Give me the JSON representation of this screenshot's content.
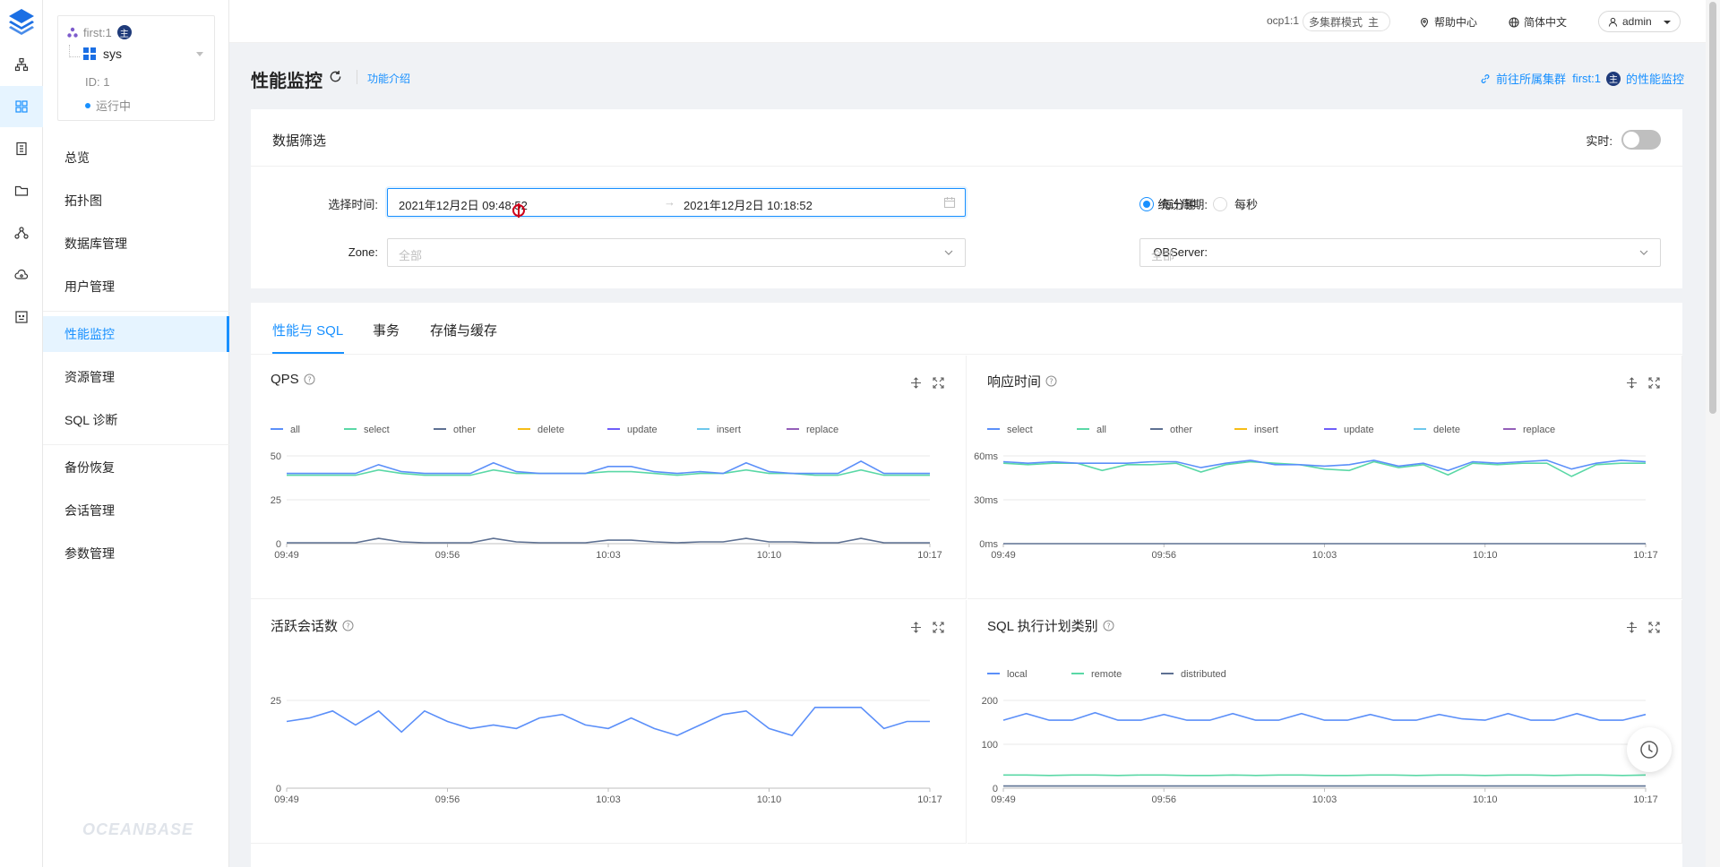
{
  "sidebar": {
    "cluster": "first:1",
    "main_badge": "主",
    "tenant": "sys",
    "tenant_id": "ID: 1",
    "status": "运行中",
    "menu": [
      "总览",
      "拓扑图",
      "数据库管理",
      "用户管理",
      "性能监控",
      "资源管理",
      "SQL 诊断",
      "备份恢复",
      "会话管理",
      "参数管理"
    ],
    "active": "性能监控",
    "brand": "OCEANBASE"
  },
  "topbar": {
    "ocp": "ocp1:1",
    "mode": "多集群模式",
    "mode_badge": "主",
    "help": "帮助中心",
    "lang": "简体中文",
    "user": "admin"
  },
  "page": {
    "title": "性能监控",
    "func_link": "功能介绍",
    "goto_prefix": "前往所属集群",
    "goto_cluster": "first:1",
    "goto_badge": "主",
    "goto_suffix": "的性能监控"
  },
  "filter": {
    "title": "数据筛选",
    "realtime_label": "实时:",
    "time_label": "选择时间:",
    "start": "2021年12月2日 09:48:52",
    "range_sep": "→",
    "end": "2021年12月2日 10:18:52",
    "period_label": "统计周期:",
    "period_options": [
      "每分钟",
      "每秒"
    ],
    "zone_label": "Zone:",
    "zone_placeholder": "全部",
    "observer_label": "OBServer:",
    "observer_placeholder": "全部"
  },
  "tabs": [
    "性能与 SQL",
    "事务",
    "存储与缓存"
  ],
  "colors": {
    "primary": "#1890ff",
    "series": [
      "#5b8ff9",
      "#5ad8a6",
      "#5d7092",
      "#f6bd16",
      "#6f5ef9",
      "#6dc8ec",
      "#945fb9"
    ]
  },
  "chart_data": [
    {
      "type": "line",
      "title": "QPS",
      "x_ticks": [
        "09:49",
        "09:56",
        "10:03",
        "10:10",
        "10:17"
      ],
      "y_ticks": [
        "0",
        "25",
        "50"
      ],
      "ylim": [
        0,
        50
      ],
      "legend": [
        "all",
        "select",
        "other",
        "delete",
        "update",
        "insert",
        "replace"
      ],
      "series": [
        {
          "name": "all",
          "values": [
            40,
            40,
            40,
            40,
            45,
            41,
            40,
            40,
            40,
            46,
            41,
            40,
            40,
            40,
            44,
            44,
            41,
            40,
            41,
            40,
            46,
            41,
            40,
            40,
            40,
            47,
            40,
            40,
            40
          ]
        },
        {
          "name": "select",
          "values": [
            39,
            39,
            39,
            39,
            42,
            40,
            39,
            39,
            39,
            42,
            40,
            40,
            40,
            40,
            41,
            41,
            40,
            39,
            40,
            40,
            42,
            40,
            40,
            39,
            39,
            42,
            39,
            39,
            39
          ]
        },
        {
          "name": "other",
          "values": [
            0.5,
            0.5,
            0.5,
            0.5,
            3,
            1,
            0.5,
            0.5,
            0.5,
            3,
            1,
            0.5,
            0.5,
            0.5,
            2,
            2,
            1,
            0.5,
            1,
            1,
            3,
            1,
            1,
            0.5,
            0.5,
            3,
            0.5,
            0.5,
            0.5
          ]
        }
      ]
    },
    {
      "type": "line",
      "title": "响应时间",
      "x_ticks": [
        "09:49",
        "09:56",
        "10:03",
        "10:10",
        "10:17"
      ],
      "y_ticks": [
        "0ms",
        "30ms",
        "60ms"
      ],
      "ylim": [
        0,
        60
      ],
      "legend": [
        "select",
        "all",
        "other",
        "insert",
        "update",
        "delete",
        "replace"
      ],
      "series": [
        {
          "name": "select",
          "values": [
            56,
            55,
            56,
            55,
            55,
            55,
            56,
            56,
            52,
            55,
            57,
            54,
            54,
            53,
            54,
            57,
            53,
            55,
            50,
            56,
            55,
            56,
            57,
            51,
            55,
            57,
            56
          ]
        },
        {
          "name": "all",
          "values": [
            55,
            54,
            55,
            55,
            50,
            54,
            54,
            55,
            49,
            54,
            56,
            55,
            54,
            51,
            50,
            56,
            52,
            54,
            47,
            55,
            54,
            55,
            55,
            46,
            54,
            55,
            55
          ]
        },
        {
          "name": "other",
          "values": [
            0,
            0,
            0,
            0,
            0,
            0,
            0,
            0,
            0,
            0,
            0,
            0,
            0,
            0,
            0,
            0,
            0,
            0,
            0,
            0,
            0,
            0,
            0,
            0,
            0,
            0,
            0
          ]
        }
      ]
    },
    {
      "type": "line",
      "title": "活跃会话数",
      "x_ticks": [
        "09:49",
        "09:56",
        "10:03",
        "10:10",
        "10:17"
      ],
      "y_ticks": [
        "0",
        "25"
      ],
      "ylim": [
        0,
        25
      ],
      "legend": [],
      "series": [
        {
          "name": "",
          "values": [
            19,
            20,
            22,
            18,
            22,
            16,
            22,
            19,
            17,
            18,
            17,
            20,
            21,
            18,
            17,
            20,
            17,
            15,
            18,
            21,
            22,
            17,
            15,
            23,
            23,
            23,
            17,
            19,
            19
          ]
        }
      ]
    },
    {
      "type": "line",
      "title": "SQL 执行计划类别",
      "x_ticks": [
        "09:49",
        "09:56",
        "10:03",
        "10:10",
        "10:17"
      ],
      "y_ticks": [
        "0",
        "100",
        "200"
      ],
      "ylim": [
        0,
        200
      ],
      "legend": [
        "local",
        "remote",
        "distributed"
      ],
      "series": [
        {
          "name": "local",
          "values": [
            155,
            170,
            155,
            155,
            172,
            155,
            155,
            168,
            155,
            155,
            170,
            155,
            155,
            170,
            155,
            155,
            168,
            155,
            155,
            168,
            158,
            155,
            170,
            155,
            155,
            170,
            155,
            155,
            168
          ]
        },
        {
          "name": "remote",
          "values": [
            30,
            30,
            29,
            30,
            30,
            29,
            30,
            30,
            29,
            29,
            30,
            29,
            30,
            30,
            29,
            29,
            30,
            30,
            29,
            30,
            30,
            29,
            30,
            30,
            29,
            30,
            30,
            29,
            30
          ]
        },
        {
          "name": "distributed",
          "values": [
            5,
            5,
            5,
            5,
            5,
            5,
            5,
            5,
            5,
            5,
            5,
            5,
            5,
            5,
            5,
            5,
            5,
            5,
            5,
            5,
            5,
            5,
            5,
            5,
            5,
            5,
            5,
            5,
            5
          ]
        }
      ]
    }
  ]
}
